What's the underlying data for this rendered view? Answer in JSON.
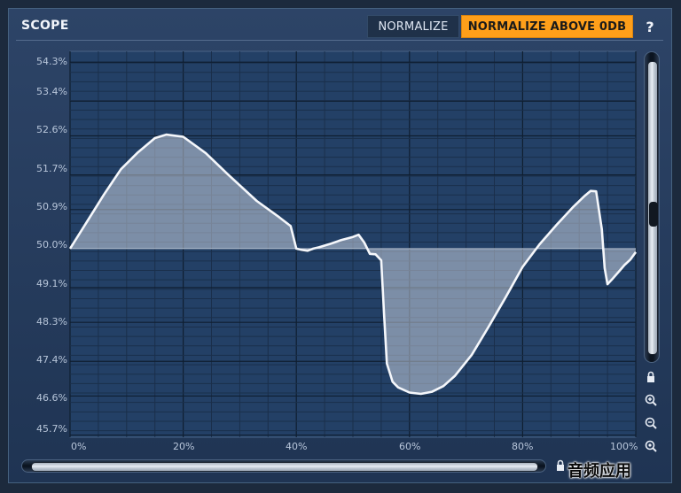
{
  "header": {
    "title": "SCOPE",
    "normalize_label": "NORMALIZE",
    "normalize_above_label": "NORMALIZE ABOVE 0DB",
    "help_label": "?"
  },
  "colors": {
    "accent": "#ff9f1a",
    "panel": "#2d4467",
    "curve": "#f5f7fb"
  },
  "icons": {
    "lock": "lock-icon",
    "zoom_in": "zoom-in-icon",
    "zoom_out": "zoom-out-icon",
    "zoom_fit": "zoom-fit-icon"
  },
  "y_axis": {
    "ticks": [
      "54.3%",
      "53.4%",
      "52.6%",
      "51.7%",
      "50.9%",
      "50.0%",
      "49.1%",
      "48.3%",
      "47.4%",
      "46.6%",
      "45.7%"
    ]
  },
  "x_axis": {
    "ticks": [
      "0%",
      "20%",
      "40%",
      "60%",
      "80%",
      "100%"
    ]
  },
  "waveform": {
    "x_percent": [
      0,
      3,
      6,
      9,
      12,
      15,
      17,
      20,
      24,
      28,
      33,
      37,
      39,
      40,
      41,
      42,
      43,
      44,
      46,
      48,
      50,
      51,
      52,
      53,
      54,
      55,
      55.5,
      56,
      57,
      58,
      60,
      62,
      64,
      66,
      68,
      71,
      74,
      77,
      80,
      83,
      86,
      89,
      91,
      92,
      93,
      94,
      94.5,
      95,
      96,
      97,
      98,
      99,
      100
    ],
    "y_percent": [
      50.0,
      50.62,
      51.25,
      51.83,
      52.22,
      52.55,
      52.63,
      52.58,
      52.2,
      51.7,
      51.1,
      50.72,
      50.52,
      50.0,
      49.97,
      49.95,
      50.0,
      50.03,
      50.11,
      50.2,
      50.27,
      50.32,
      50.14,
      49.88,
      49.87,
      49.73,
      48.5,
      47.35,
      46.93,
      46.8,
      46.68,
      46.65,
      46.7,
      46.83,
      47.06,
      47.55,
      48.2,
      48.88,
      49.58,
      50.1,
      50.55,
      50.97,
      51.22,
      51.33,
      51.32,
      50.45,
      49.55,
      49.18,
      49.32,
      49.47,
      49.62,
      49.74,
      49.92
    ]
  },
  "watermark": "音频应用"
}
